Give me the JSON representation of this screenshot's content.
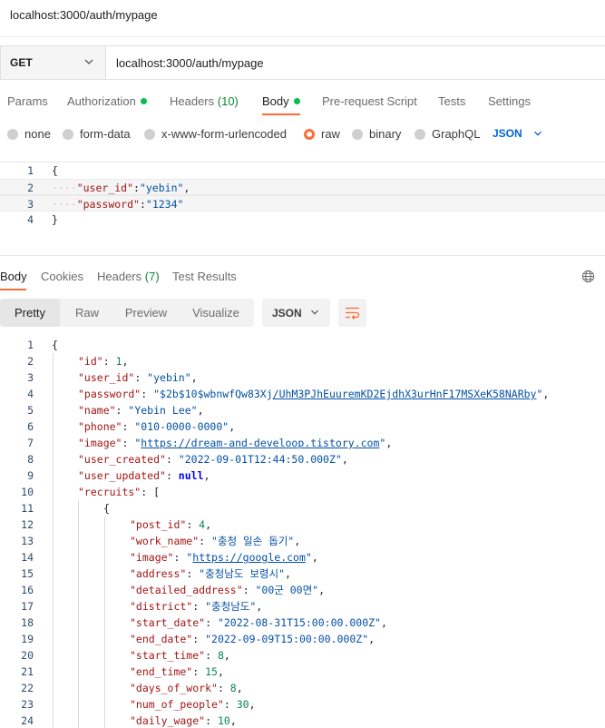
{
  "window": {
    "title": "localhost:3000/auth/mypage"
  },
  "request": {
    "method": "GET",
    "url": "localhost:3000/auth/mypage",
    "tabs": [
      {
        "label": "Params",
        "dot": false,
        "count": ""
      },
      {
        "label": "Authorization",
        "dot": true,
        "count": ""
      },
      {
        "label": "Headers",
        "dot": false,
        "count": "(10)"
      },
      {
        "label": "Body",
        "dot": true,
        "count": "",
        "active": true
      },
      {
        "label": "Pre-request Script",
        "dot": false,
        "count": ""
      },
      {
        "label": "Tests",
        "dot": false,
        "count": ""
      },
      {
        "label": "Settings",
        "dot": false,
        "count": ""
      }
    ],
    "body_types": [
      "none",
      "form-data",
      "x-www-form-urlencoded",
      "raw",
      "binary",
      "GraphQL"
    ],
    "selected_body_type": "raw",
    "language": "JSON",
    "body_lines": [
      {
        "num": "1",
        "tokens": [
          {
            "t": "{",
            "c": "p"
          }
        ]
      },
      {
        "num": "2",
        "tokens": [
          {
            "t": "····",
            "c": "ws"
          },
          {
            "t": "\"user_id\"",
            "c": "k"
          },
          {
            "t": ":",
            "c": "p"
          },
          {
            "t": "\"yebin\"",
            "c": "s"
          },
          {
            "t": ",",
            "c": "p"
          }
        ]
      },
      {
        "num": "3",
        "tokens": [
          {
            "t": "····",
            "c": "ws"
          },
          {
            "t": "\"password\"",
            "c": "k"
          },
          {
            "t": ":",
            "c": "p"
          },
          {
            "t": "\"1234\"",
            "c": "s"
          }
        ]
      },
      {
        "num": "4",
        "tokens": [
          {
            "t": "}",
            "c": "p"
          }
        ]
      }
    ]
  },
  "response": {
    "tabs": [
      {
        "label": "Body",
        "count": "",
        "active": true
      },
      {
        "label": "Cookies",
        "count": ""
      },
      {
        "label": "Headers",
        "count": "(7)"
      },
      {
        "label": "Test Results",
        "count": ""
      }
    ],
    "view_modes": [
      "Pretty",
      "Raw",
      "Preview",
      "Visualize"
    ],
    "active_view": "Pretty",
    "format": "JSON",
    "lines": [
      {
        "num": "1",
        "indent": 0,
        "tokens": [
          {
            "t": "{",
            "c": "p"
          }
        ]
      },
      {
        "num": "2",
        "indent": 1,
        "tokens": [
          {
            "t": "\"id\"",
            "c": "k"
          },
          {
            "t": ": ",
            "c": "p"
          },
          {
            "t": "1",
            "c": "n"
          },
          {
            "t": ",",
            "c": "p"
          }
        ]
      },
      {
        "num": "3",
        "indent": 1,
        "tokens": [
          {
            "t": "\"user_id\"",
            "c": "k"
          },
          {
            "t": ": ",
            "c": "p"
          },
          {
            "t": "\"yebin\"",
            "c": "s"
          },
          {
            "t": ",",
            "c": "p"
          }
        ]
      },
      {
        "num": "4",
        "indent": 1,
        "tokens": [
          {
            "t": "\"password\"",
            "c": "k"
          },
          {
            "t": ": ",
            "c": "p"
          },
          {
            "t": "\"$2b$10$wbnwfQw83Xj",
            "c": "s"
          },
          {
            "t": "/UhM3PJhEuuremKD2EjdhX3urHnF17MSXeK58NARby",
            "c": "lnk"
          },
          {
            "t": "\"",
            "c": "s"
          },
          {
            "t": ",",
            "c": "p"
          }
        ]
      },
      {
        "num": "5",
        "indent": 1,
        "tokens": [
          {
            "t": "\"name\"",
            "c": "k"
          },
          {
            "t": ": ",
            "c": "p"
          },
          {
            "t": "\"Yebin Lee\"",
            "c": "s"
          },
          {
            "t": ",",
            "c": "p"
          }
        ]
      },
      {
        "num": "6",
        "indent": 1,
        "tokens": [
          {
            "t": "\"phone\"",
            "c": "k"
          },
          {
            "t": ": ",
            "c": "p"
          },
          {
            "t": "\"010-0000-0000\"",
            "c": "s"
          },
          {
            "t": ",",
            "c": "p"
          }
        ]
      },
      {
        "num": "7",
        "indent": 1,
        "tokens": [
          {
            "t": "\"image\"",
            "c": "k"
          },
          {
            "t": ": ",
            "c": "p"
          },
          {
            "t": "\"",
            "c": "s"
          },
          {
            "t": "https://dream-and-develoop.tistory.com",
            "c": "lnk"
          },
          {
            "t": "\"",
            "c": "s"
          },
          {
            "t": ",",
            "c": "p"
          }
        ]
      },
      {
        "num": "8",
        "indent": 1,
        "tokens": [
          {
            "t": "\"user_created\"",
            "c": "k"
          },
          {
            "t": ": ",
            "c": "p"
          },
          {
            "t": "\"2022-09-01T12:44:50.000Z\"",
            "c": "s"
          },
          {
            "t": ",",
            "c": "p"
          }
        ]
      },
      {
        "num": "9",
        "indent": 1,
        "tokens": [
          {
            "t": "\"user_updated\"",
            "c": "k"
          },
          {
            "t": ": ",
            "c": "p"
          },
          {
            "t": "null",
            "c": "kw"
          },
          {
            "t": ",",
            "c": "p"
          }
        ]
      },
      {
        "num": "10",
        "indent": 1,
        "tokens": [
          {
            "t": "\"recruits\"",
            "c": "k"
          },
          {
            "t": ": [",
            "c": "p"
          }
        ]
      },
      {
        "num": "11",
        "indent": 2,
        "tokens": [
          {
            "t": "{",
            "c": "p"
          }
        ]
      },
      {
        "num": "12",
        "indent": 3,
        "tokens": [
          {
            "t": "\"post_id\"",
            "c": "k"
          },
          {
            "t": ": ",
            "c": "p"
          },
          {
            "t": "4",
            "c": "n"
          },
          {
            "t": ",",
            "c": "p"
          }
        ]
      },
      {
        "num": "13",
        "indent": 3,
        "tokens": [
          {
            "t": "\"work_name\"",
            "c": "k"
          },
          {
            "t": ": ",
            "c": "p"
          },
          {
            "t": "\"충청 일손 돕기\"",
            "c": "s"
          },
          {
            "t": ",",
            "c": "p"
          }
        ]
      },
      {
        "num": "14",
        "indent": 3,
        "tokens": [
          {
            "t": "\"image\"",
            "c": "k"
          },
          {
            "t": ": ",
            "c": "p"
          },
          {
            "t": "\"",
            "c": "s"
          },
          {
            "t": "https://google.com",
            "c": "lnk"
          },
          {
            "t": "\"",
            "c": "s"
          },
          {
            "t": ",",
            "c": "p"
          }
        ]
      },
      {
        "num": "15",
        "indent": 3,
        "tokens": [
          {
            "t": "\"address\"",
            "c": "k"
          },
          {
            "t": ": ",
            "c": "p"
          },
          {
            "t": "\"충청남도 보령시\"",
            "c": "s"
          },
          {
            "t": ",",
            "c": "p"
          }
        ]
      },
      {
        "num": "16",
        "indent": 3,
        "tokens": [
          {
            "t": "\"detailed_address\"",
            "c": "k"
          },
          {
            "t": ": ",
            "c": "p"
          },
          {
            "t": "\"00군 00면\"",
            "c": "s"
          },
          {
            "t": ",",
            "c": "p"
          }
        ]
      },
      {
        "num": "17",
        "indent": 3,
        "tokens": [
          {
            "t": "\"district\"",
            "c": "k"
          },
          {
            "t": ": ",
            "c": "p"
          },
          {
            "t": "\"충청남도\"",
            "c": "s"
          },
          {
            "t": ",",
            "c": "p"
          }
        ]
      },
      {
        "num": "18",
        "indent": 3,
        "tokens": [
          {
            "t": "\"start_date\"",
            "c": "k"
          },
          {
            "t": ": ",
            "c": "p"
          },
          {
            "t": "\"2022-08-31T15:00:00.000Z\"",
            "c": "s"
          },
          {
            "t": ",",
            "c": "p"
          }
        ]
      },
      {
        "num": "19",
        "indent": 3,
        "tokens": [
          {
            "t": "\"end_date\"",
            "c": "k"
          },
          {
            "t": ": ",
            "c": "p"
          },
          {
            "t": "\"2022-09-09T15:00:00.000Z\"",
            "c": "s"
          },
          {
            "t": ",",
            "c": "p"
          }
        ]
      },
      {
        "num": "20",
        "indent": 3,
        "tokens": [
          {
            "t": "\"start_time\"",
            "c": "k"
          },
          {
            "t": ": ",
            "c": "p"
          },
          {
            "t": "8",
            "c": "n"
          },
          {
            "t": ",",
            "c": "p"
          }
        ]
      },
      {
        "num": "21",
        "indent": 3,
        "tokens": [
          {
            "t": "\"end_time\"",
            "c": "k"
          },
          {
            "t": ": ",
            "c": "p"
          },
          {
            "t": "15",
            "c": "n"
          },
          {
            "t": ",",
            "c": "p"
          }
        ]
      },
      {
        "num": "22",
        "indent": 3,
        "tokens": [
          {
            "t": "\"days_of_work\"",
            "c": "k"
          },
          {
            "t": ": ",
            "c": "p"
          },
          {
            "t": "8",
            "c": "n"
          },
          {
            "t": ",",
            "c": "p"
          }
        ]
      },
      {
        "num": "23",
        "indent": 3,
        "tokens": [
          {
            "t": "\"num_of_people\"",
            "c": "k"
          },
          {
            "t": ": ",
            "c": "p"
          },
          {
            "t": "30",
            "c": "n"
          },
          {
            "t": ",",
            "c": "p"
          }
        ]
      },
      {
        "num": "24",
        "indent": 3,
        "tokens": [
          {
            "t": "\"daily_wage\"",
            "c": "k"
          },
          {
            "t": ": ",
            "c": "p"
          },
          {
            "t": "10",
            "c": "n"
          },
          {
            "t": ",",
            "c": "p"
          }
        ]
      }
    ]
  },
  "colors": {
    "accent": "#ff6c37",
    "status_dot": "#0cbb52",
    "link": "#0265d2"
  },
  "icons": {
    "method_chevron": "chevron-down-icon",
    "language_chevron": "chevron-down-icon",
    "globe": "globe-icon",
    "wrap": "wrap-lines-icon"
  }
}
